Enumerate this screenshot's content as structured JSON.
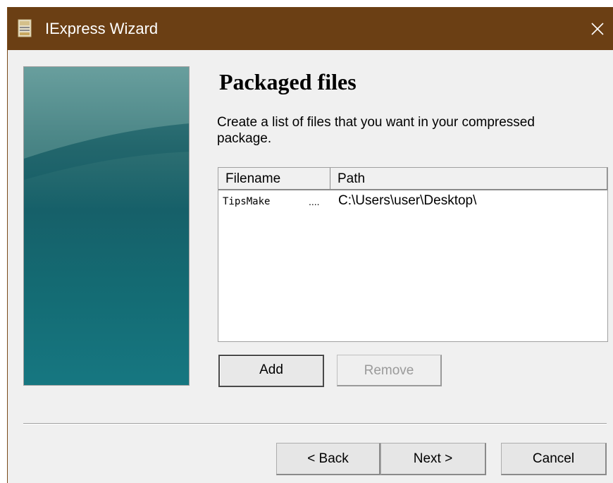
{
  "window": {
    "title": "IExpress Wizard",
    "title_bar_color": "#6b3f14",
    "app_icon": "iexpress-app-icon",
    "close_icon": "close-icon"
  },
  "page": {
    "title": "Packaged files",
    "description": "Create a list of files that you want in your compressed package."
  },
  "file_list": {
    "columns": [
      "Filename",
      "Path"
    ],
    "rows": [
      {
        "filename": "TipsMake",
        "ellipsis": "....",
        "path": "C:\\Users\\user\\Desktop\\"
      }
    ]
  },
  "buttons": {
    "add": "Add",
    "remove": "Remove",
    "back": "< Back",
    "next": "Next >",
    "cancel": "Cancel"
  }
}
